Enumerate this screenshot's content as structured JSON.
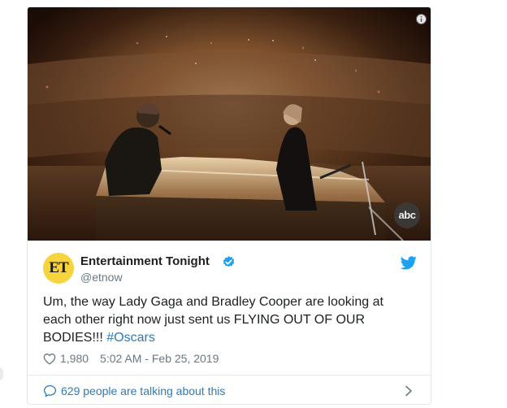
{
  "tweet": {
    "author": {
      "display_name": "Entertainment Tonight",
      "handle": "@etnow",
      "avatar_text": "ET",
      "verified": true
    },
    "text_before_hashtag": "Um, the way Lady Gaga and Bradley Cooper are looking at each other right now just sent us FLYING OUT OF OUR BODIES!!! ",
    "hashtag": "#Oscars",
    "likes": "1,980",
    "timestamp": "5:02 AM - Feb 25, 2019",
    "conversation": "629 people are talking about this"
  },
  "media": {
    "watermark": "abc"
  },
  "icons": {
    "info": "info-icon",
    "verified": "verified-badge-icon",
    "twitter": "twitter-bird-icon",
    "like": "heart-icon",
    "reply": "speech-bubble-icon",
    "more": "chevron-right-icon"
  },
  "colors": {
    "link": "#2b7bb9",
    "meta": "#697882",
    "twitter_blue": "#1da1f2",
    "avatar_bg": "#f7d33d"
  }
}
